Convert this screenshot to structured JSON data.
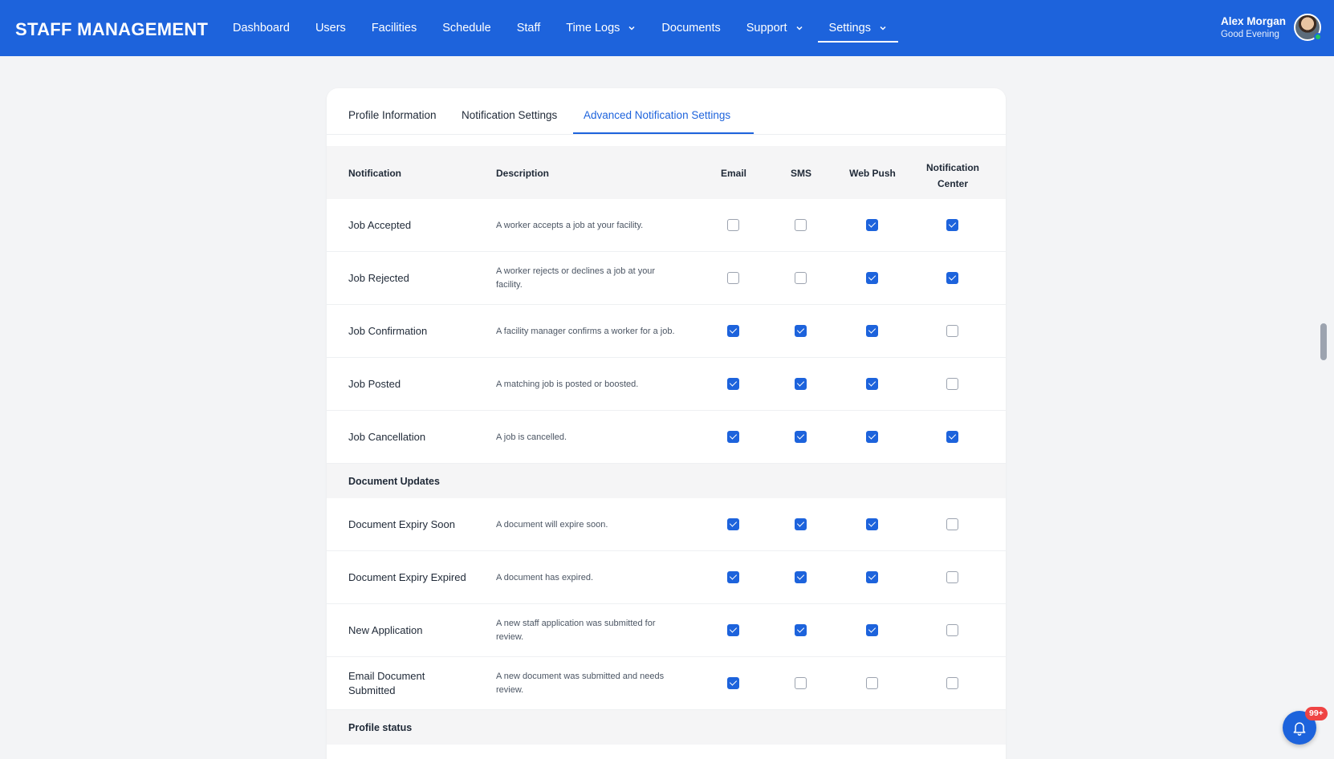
{
  "app": {
    "title": "STAFF MANAGEMENT"
  },
  "nav": {
    "items": [
      {
        "label": "Dashboard"
      },
      {
        "label": "Users"
      },
      {
        "label": "Facilities"
      },
      {
        "label": "Schedule"
      },
      {
        "label": "Staff"
      },
      {
        "label": "Time Logs"
      },
      {
        "label": "Documents"
      },
      {
        "label": "Support"
      },
      {
        "label": "Settings"
      }
    ]
  },
  "user": {
    "name": "Alex Morgan",
    "greeting": "Good Evening"
  },
  "tabs": [
    {
      "label": "Profile Information"
    },
    {
      "label": "Notification Settings"
    },
    {
      "label": "Advanced Notification Settings"
    }
  ],
  "table": {
    "headers": {
      "notification": "Notification",
      "description": "Description",
      "email": "Email",
      "sms": "SMS",
      "web_push": "Web Push",
      "center_line1": "Notification",
      "center_line2": "Center"
    },
    "rows": [
      {
        "name": "Job Accepted",
        "desc": "A worker accepts a job at your facility.",
        "email": false,
        "sms": false,
        "push": true,
        "center": true
      },
      {
        "name": "Job Rejected",
        "desc": "A worker rejects or declines a job at your facility.",
        "email": false,
        "sms": false,
        "push": true,
        "center": true
      },
      {
        "name": "Job Confirmation",
        "desc": "A facility manager confirms a worker for a job.",
        "email": true,
        "sms": true,
        "push": true,
        "center": false
      },
      {
        "name": "Job Posted",
        "desc": "A matching job is posted or boosted.",
        "email": true,
        "sms": true,
        "push": true,
        "center": false
      },
      {
        "name": "Job Cancellation",
        "desc": "A job is cancelled.",
        "email": true,
        "sms": true,
        "push": true,
        "center": true
      }
    ],
    "section_document": "Document Updates",
    "doc_rows": [
      {
        "name": "Document Expiry Soon",
        "desc": "A document will expire soon.",
        "email": true,
        "sms": true,
        "push": true,
        "center": false
      },
      {
        "name": "Document Expiry Expired",
        "desc": "A document has expired.",
        "email": true,
        "sms": true,
        "push": true,
        "center": false
      },
      {
        "name": "New Application",
        "desc": "A new staff application was submitted for review.",
        "email": true,
        "sms": true,
        "push": true,
        "center": false
      },
      {
        "name": "Email Document Submitted",
        "desc": "A new document was submitted and needs review.",
        "email": true,
        "sms": false,
        "push": false,
        "center": false
      }
    ],
    "section_profile": "Profile status"
  },
  "notifications_badge": "99+",
  "colors": {
    "primary": "#1d63dc",
    "badge": "#ef4444"
  }
}
